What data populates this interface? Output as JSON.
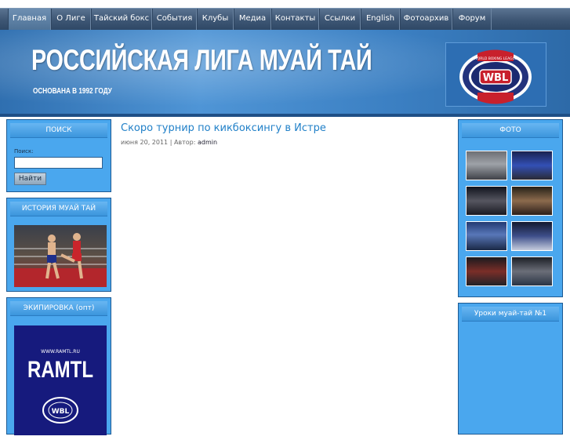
{
  "nav": {
    "items": [
      "Главная",
      "О Лиге",
      "Тайский бокс",
      "События",
      "Клубы",
      "Медиа",
      "Контакты",
      "Ссылки",
      "English",
      "Фотоархив",
      "Форум"
    ]
  },
  "header": {
    "title": "РОССИЙСКАЯ ЛИГА МУАЙ ТАЙ",
    "subtitle": "ОСНОВАНА В 1992 ГОДУ",
    "logo_text": "WBL",
    "logo_ring_text": "WORLD BOXING LEAGUE"
  },
  "sidebar_left": {
    "search": {
      "title": "ПОИСК",
      "label": "Поиск:",
      "input_value": "",
      "button_label": "Найти"
    },
    "history": {
      "title": "ИСТОРИЯ МУАЙ ТАЙ"
    },
    "equipment": {
      "title": "ЭКИПИРОВКА (опт)",
      "ad_site": "WWW.RAMTL.RU",
      "ad_brand": "RAMTL",
      "ad_badge": "WBL"
    }
  },
  "post": {
    "title": "Скоро турнир по кикбоксингу в Истре",
    "date": "июня 20, 2011",
    "author_prefix": "| Автор:",
    "author": "admin"
  },
  "sidebar_right": {
    "photos": {
      "title": "ФОТО"
    },
    "lessons": {
      "title": "Уроки муай-тай №1"
    }
  },
  "colors": {
    "nav": "#3d5674",
    "header": "#4f95d6",
    "sidebar_box": "#4aa7ee",
    "post_title": "#2180c8"
  }
}
